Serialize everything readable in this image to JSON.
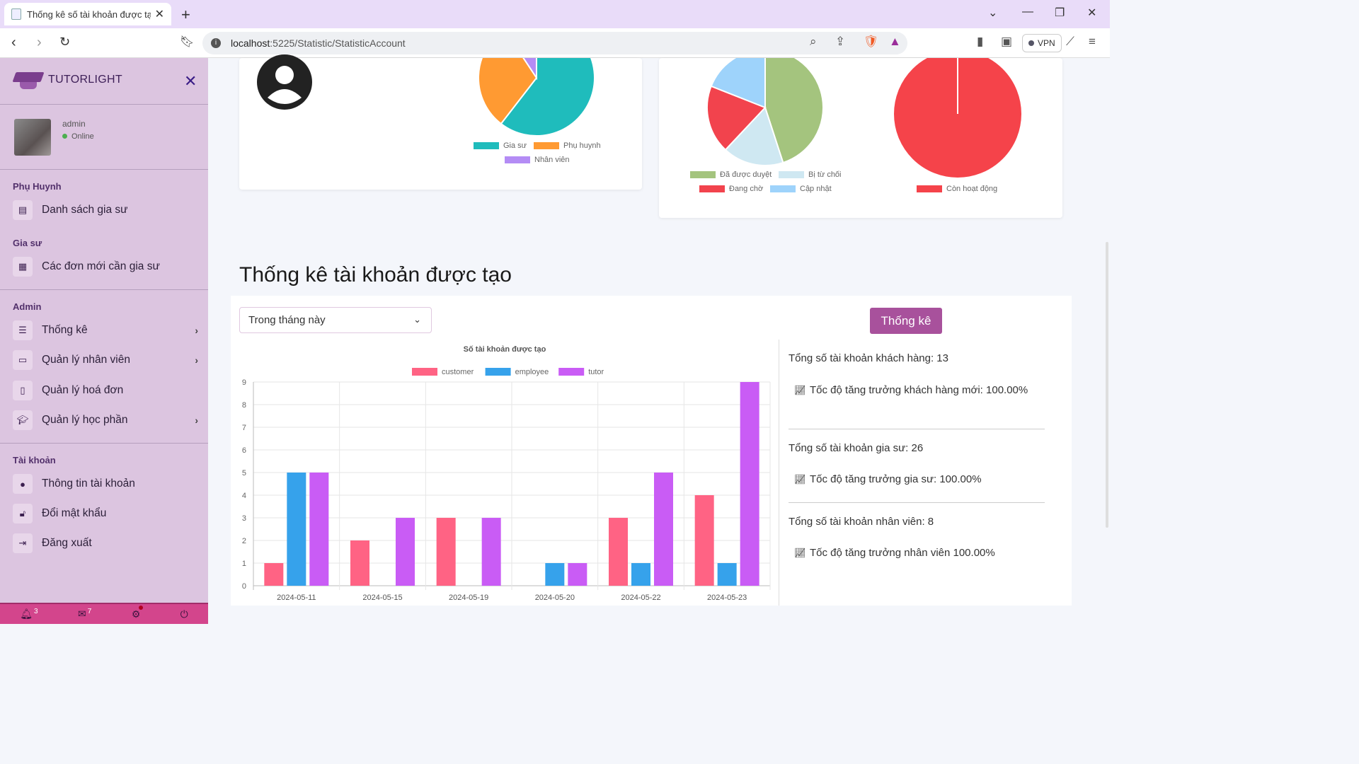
{
  "browser": {
    "tab_title": "Thống kê số tài khoản được tạo",
    "url_host": "localhost",
    "url_path": ":5225/Statistic/StatisticAccount",
    "vpn_label": "VPN"
  },
  "sidebar": {
    "brand": "TUTORLIGHT",
    "user": {
      "name": "admin",
      "status": "Online"
    },
    "sections": [
      {
        "title": "Phụ Huynh",
        "items": [
          {
            "label": "Danh sách gia sư",
            "icon": "id-card-icon"
          }
        ]
      },
      {
        "title": "Gia sư",
        "items": [
          {
            "label": "Các đơn mới cần gia sư",
            "icon": "calendar-icon"
          }
        ]
      },
      {
        "title": "Admin",
        "items": [
          {
            "label": "Thống kê",
            "icon": "list-icon",
            "has_submenu": true
          },
          {
            "label": "Quản lý nhân viên",
            "icon": "laptop-icon",
            "has_submenu": true
          },
          {
            "label": "Quản lý hoá đơn",
            "icon": "invoice-icon",
            "has_submenu": false
          },
          {
            "label": "Quản lý học phần",
            "icon": "graduation-cap-icon",
            "has_submenu": true
          }
        ]
      },
      {
        "title": "Tài khoản",
        "items": [
          {
            "label": "Thông tin tài khoản",
            "icon": "info-icon"
          },
          {
            "label": "Đổi mật khẩu",
            "icon": "lock-icon"
          },
          {
            "label": "Đăng xuất",
            "icon": "logout-icon"
          }
        ]
      }
    ],
    "footer": {
      "notifications": "3",
      "messages": "7"
    }
  },
  "top_charts": {
    "account_types": {
      "legend": [
        "Gia sư",
        "Phụ huynh",
        "Nhân viên"
      ],
      "colors": [
        "#1fbcbc",
        "#ff9a32",
        "#b48cf5"
      ]
    },
    "request_status": {
      "legend": [
        "Đã được duyệt",
        "Bị từ chối",
        "Đang chờ",
        "Cập nhật"
      ],
      "colors": [
        "#a4c47e",
        "#cfe8f2",
        "#f2434d",
        "#9ed3fb"
      ]
    },
    "activity": {
      "legend": [
        "Còn hoạt động"
      ],
      "colors": [
        "#f5434a"
      ]
    }
  },
  "main": {
    "title": "Thống kê tài khoản được tạo",
    "period_select": "Trong tháng này",
    "submit_label": "Thống kê",
    "stats": [
      {
        "total": "Tổng số tài khoản khách hàng: 13",
        "growth": "Tốc độ tăng trưởng khách hàng mới: 100.00%"
      },
      {
        "total": "Tổng số tài khoản gia sư: 26",
        "growth": "Tốc độ tăng trưởng gia sư: 100.00%"
      },
      {
        "total": "Tổng số tài khoản nhân viên: 8",
        "growth": "Tốc độ tăng trưởng nhân viên 100.00%"
      }
    ]
  },
  "chart_data": [
    {
      "type": "pie",
      "labels": [
        "Gia sư",
        "Phụ huynh",
        "Nhân viên"
      ],
      "values": [
        26,
        13,
        4
      ],
      "colors": [
        "#1fbcbc",
        "#ff9a32",
        "#b48cf5"
      ]
    },
    {
      "type": "pie",
      "labels": [
        "Đã được duyệt",
        "Bị từ chối",
        "Đang chờ",
        "Cập nhật"
      ],
      "values": [
        45,
        17,
        19,
        19
      ],
      "colors": [
        "#a4c47e",
        "#cfe8f2",
        "#f2434d",
        "#9ed3fb"
      ]
    },
    {
      "type": "pie",
      "labels": [
        "Còn hoạt động"
      ],
      "values": [
        100
      ],
      "colors": [
        "#f5434a"
      ]
    },
    {
      "type": "bar",
      "title": "Số tài khoản được tạo",
      "categories": [
        "2024-05-11",
        "2024-05-15",
        "2024-05-19",
        "2024-05-20",
        "2024-05-22",
        "2024-05-23"
      ],
      "series": [
        {
          "name": "customer",
          "color": "#ff6384",
          "values": [
            1,
            2,
            3,
            0,
            3,
            4
          ]
        },
        {
          "name": "employee",
          "color": "#36a2eb",
          "values": [
            5,
            0,
            0,
            1,
            1,
            1
          ]
        },
        {
          "name": "tutor",
          "color": "#c95cf5",
          "values": [
            5,
            3,
            3,
            1,
            5,
            9
          ]
        }
      ],
      "ylim": [
        0,
        9
      ],
      "yticks": [
        0,
        1,
        2,
        3,
        4,
        5,
        6,
        7,
        8,
        9
      ],
      "grid": true,
      "legend": "top"
    }
  ]
}
